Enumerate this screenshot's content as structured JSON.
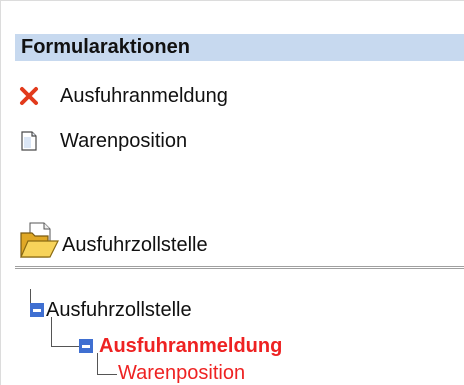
{
  "panel": {
    "header": "Formularaktionen"
  },
  "actions": [
    {
      "label": "Ausfuhranmeldung",
      "icon": "x-icon"
    },
    {
      "label": "Warenposition",
      "icon": "document-icon"
    }
  ],
  "folder": {
    "label": "Ausfuhrzollstelle",
    "icon": "open-folder-icon"
  },
  "tree": {
    "nodes": [
      {
        "label": "Ausfuhrzollstelle",
        "expanded": true
      },
      {
        "label": "Ausfuhranmeldung",
        "expanded": true,
        "selected": true
      },
      {
        "label": "Warenposition"
      }
    ]
  },
  "colors": {
    "header_bg": "#c7d9ef",
    "selected_text": "#ee2222",
    "toggle": "#3f6fd1"
  }
}
